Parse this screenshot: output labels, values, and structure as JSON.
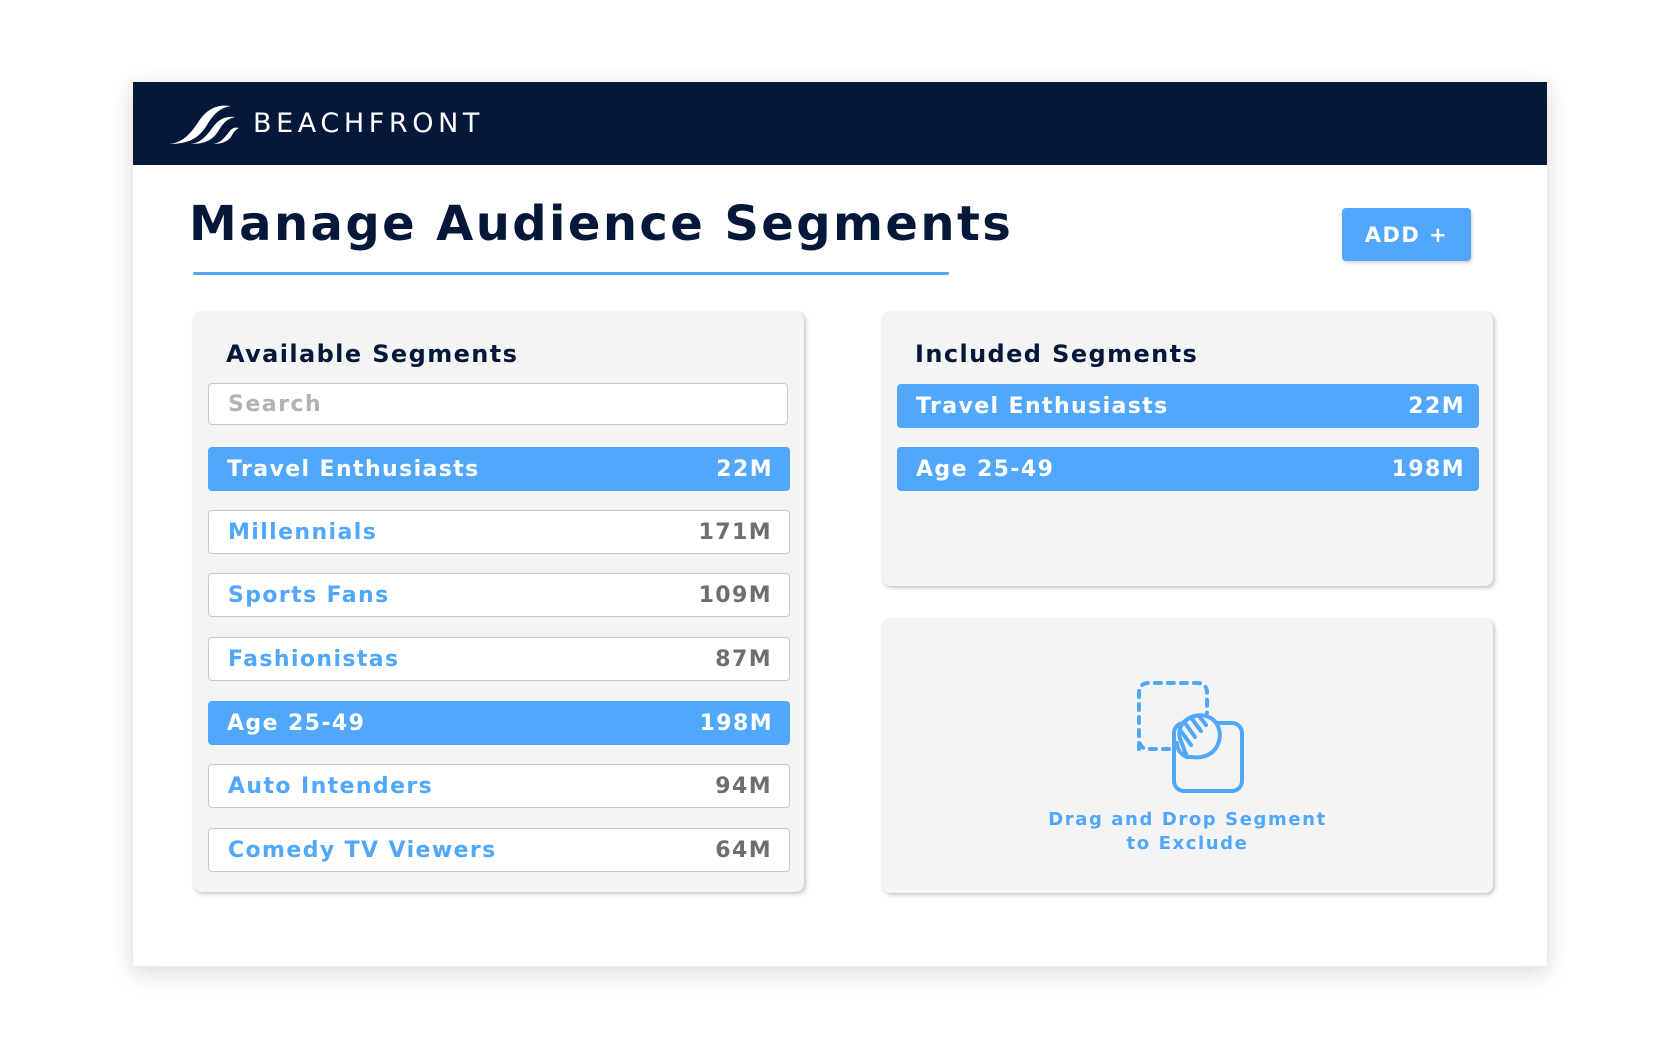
{
  "header": {
    "brand": "BEACHFRONT",
    "logo_icon": "beachfront-waves-logo",
    "background_color": "#06183a"
  },
  "page": {
    "title": "Manage Audience Segments",
    "add_button_label": "ADD +",
    "accent_color": "#51a7f9"
  },
  "available": {
    "title": "Available Segments",
    "search_placeholder": "Search",
    "search_value": "",
    "items": [
      {
        "name": "Travel Enthusiasts",
        "count": "22M",
        "selected": true
      },
      {
        "name": "Millennials",
        "count": "171M",
        "selected": false
      },
      {
        "name": "Sports Fans",
        "count": "109M",
        "selected": false
      },
      {
        "name": "Fashionistas",
        "count": "87M",
        "selected": false
      },
      {
        "name": "Age 25-49",
        "count": "198M",
        "selected": true
      },
      {
        "name": "Auto Intenders",
        "count": "94M",
        "selected": false
      },
      {
        "name": "Comedy TV Viewers",
        "count": "64M",
        "selected": false
      }
    ]
  },
  "included": {
    "title": "Included Segments",
    "items": [
      {
        "name": "Travel Enthusiasts",
        "count": "22M"
      },
      {
        "name": "Age 25-49",
        "count": "198M"
      }
    ]
  },
  "exclude": {
    "icon": "drag-and-drop-hand-icon",
    "line1": "Drag and Drop Segment",
    "line2": "to Exclude"
  }
}
